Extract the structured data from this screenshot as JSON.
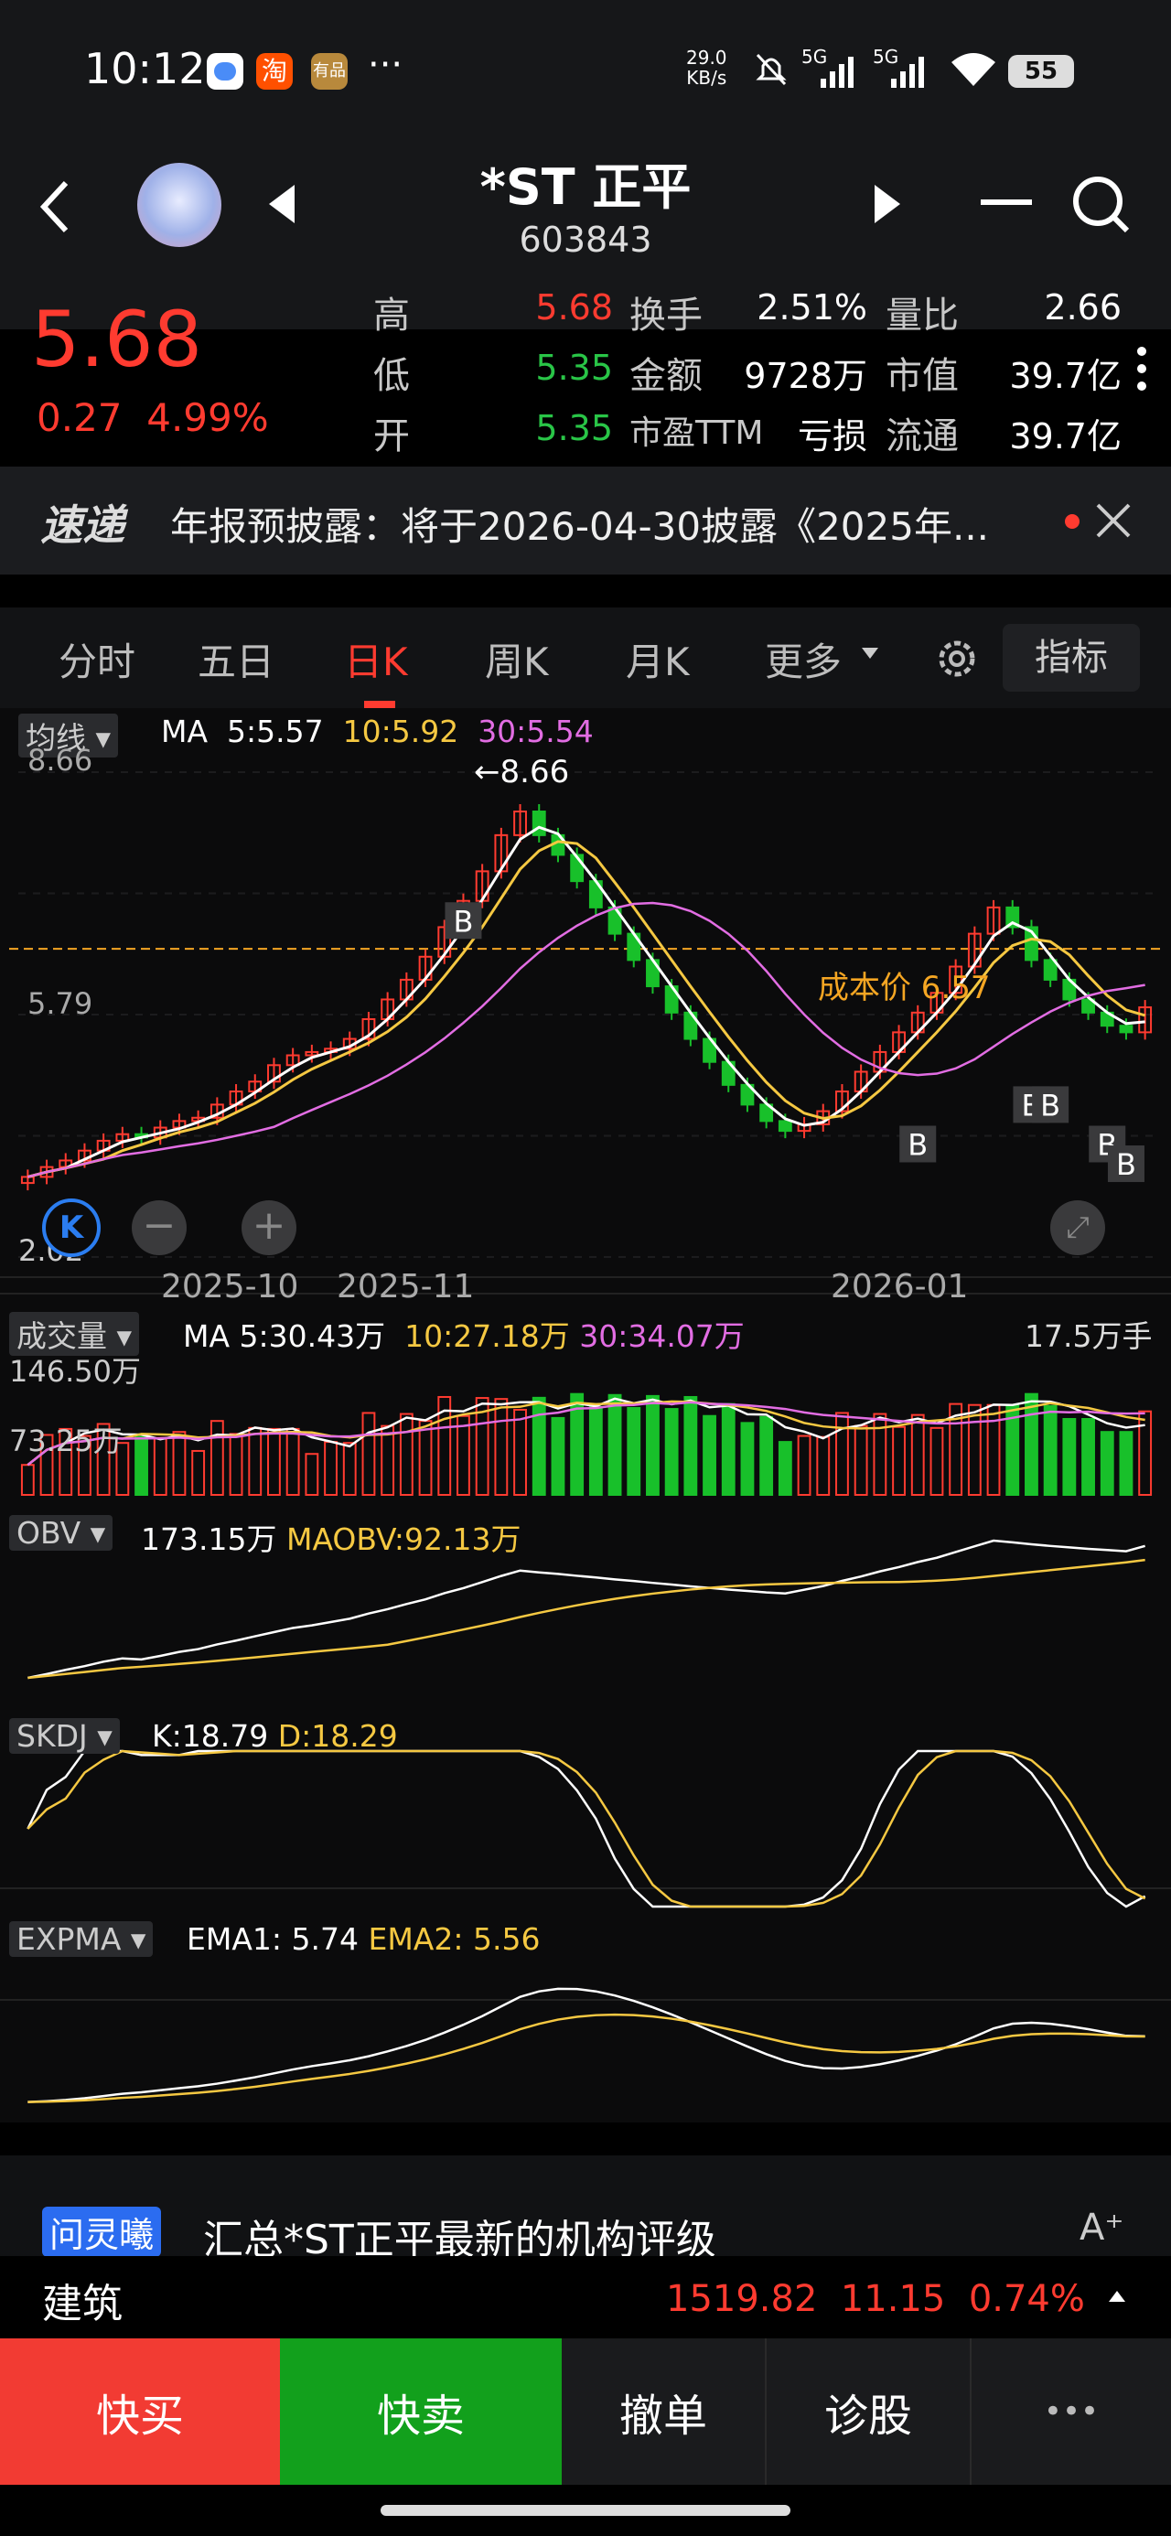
{
  "status": {
    "time": "10:12",
    "more": "···",
    "net_top": "29.0",
    "net_bottom": "KB/s",
    "sig1": "5G",
    "sig2": "5G",
    "battery": "55"
  },
  "header": {
    "title": "*ST 正平",
    "code": "603843"
  },
  "quote": {
    "price": "5.68",
    "change": "0.27",
    "pct": "4.99%",
    "labels": [
      "高",
      "低",
      "开"
    ],
    "values": [
      "5.68",
      "5.35",
      "5.35"
    ],
    "labels2": [
      "换手",
      "金额",
      "市盈TTM"
    ],
    "values2": [
      "2.51%",
      "9728万",
      "亏损"
    ],
    "labels3": [
      "量比",
      "市值",
      "流通"
    ],
    "values3": [
      "2.66",
      "39.7亿",
      "39.7亿"
    ]
  },
  "news": {
    "logo": "速递",
    "text": "年报预披露：将于2026-04-30披露《2025年..."
  },
  "tabs": [
    "分时",
    "五日",
    "日K",
    "周K",
    "月K",
    "更多"
  ],
  "indicator_btn": "指标",
  "main_chart": {
    "ma_label": "均线",
    "ma": "MA",
    "ma5": "5:5.57",
    "ma10": "10:5.92",
    "ma30": "30:5.54",
    "y_high": "8.66",
    "y_mid": "5.79",
    "y_low": "2.02",
    "max_note": "8.66",
    "min_note": "2.02",
    "cost": "成本价 6.57",
    "dates": [
      "2025-10",
      "2025-11",
      "2026-01"
    ],
    "b": "B"
  },
  "volume": {
    "label": "成交量",
    "ma": "MA",
    "ma5": "5:30.43万",
    "ma10": "10:27.18万",
    "ma30": "30:34.07万",
    "right": "17.5万手",
    "y1": "146.50万",
    "y2": "73.25万"
  },
  "obv": {
    "label": "OBV",
    "v": "173.15万",
    "ma": "MAOBV:92.13万"
  },
  "skdj": {
    "label": "SKDJ",
    "k": "K:18.79",
    "d": "D:18.29"
  },
  "expma": {
    "label": "EXPMA",
    "e1": "EMA1: 5.74",
    "e2": "EMA2: 5.56"
  },
  "ai": {
    "tag": "问灵曦",
    "text": "汇总*ST正平最新的机构评级"
  },
  "sector": {
    "name": "建筑",
    "value": "1519.82",
    "chg": "11.15",
    "pct": "0.74%"
  },
  "bottom": {
    "buy": "快买",
    "sell": "快卖",
    "cancel": "撤单",
    "diag": "诊股",
    "more": "•••"
  },
  "chart_data": {
    "type": "candlestick",
    "ylim": [
      2.02,
      8.66
    ],
    "cost_price": 6.57,
    "x_ticks": [
      "2025-10",
      "2025-11",
      "2026-01"
    ],
    "close": [
      3.1,
      3.25,
      3.35,
      3.5,
      3.65,
      3.75,
      3.7,
      3.85,
      3.95,
      4.0,
      4.2,
      4.4,
      4.55,
      4.8,
      4.95,
      5.0,
      5.05,
      5.2,
      5.5,
      5.8,
      6.1,
      6.45,
      6.9,
      7.3,
      7.75,
      8.3,
      8.66,
      8.3,
      8.0,
      7.6,
      7.2,
      6.8,
      6.4,
      6.0,
      5.6,
      5.2,
      4.85,
      4.5,
      4.2,
      3.95,
      3.8,
      3.9,
      4.1,
      4.4,
      4.7,
      5.0,
      5.3,
      5.6,
      5.9,
      6.3,
      6.8,
      7.2,
      6.9,
      6.4,
      6.1,
      5.8,
      5.6,
      5.4,
      5.3,
      5.68
    ],
    "volume_unit": "万",
    "volume_max": 146.5,
    "indicators": {
      "MA5": 5.57,
      "MA10": 5.92,
      "MA30": 5.54,
      "OBV": "173.15万",
      "MAOBV": "92.13万",
      "K": 18.79,
      "D": 18.29,
      "EMA1": 5.74,
      "EMA2": 5.56
    }
  }
}
